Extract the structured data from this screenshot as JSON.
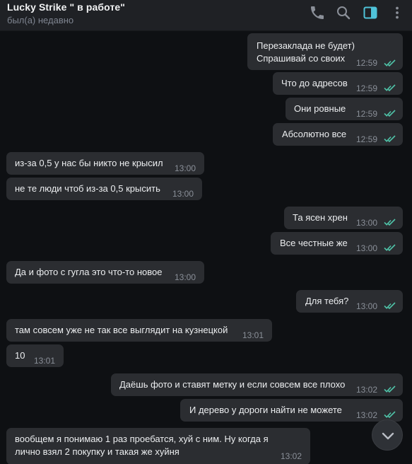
{
  "header": {
    "title": "Lucky Strike \" в работе\"",
    "status": "был(а) недавно"
  },
  "colors": {
    "accent": "#4fc3d9",
    "read_ticks": "#4fc3a8",
    "bubble": "#2b2d31",
    "background": "#0e1013"
  },
  "messages": [
    {
      "dir": "out",
      "lines": [
        "Перезаклада не будет)",
        "Спрашивай со своих"
      ],
      "time": "12:59",
      "read": true
    },
    {
      "dir": "out",
      "lines": [
        "Что до адресов"
      ],
      "time": "12:59",
      "read": true
    },
    {
      "dir": "out",
      "lines": [
        "Они ровные"
      ],
      "time": "12:59",
      "read": true
    },
    {
      "dir": "out",
      "lines": [
        "Абсолютно все"
      ],
      "time": "12:59",
      "read": true
    },
    {
      "dir": "in",
      "lines": [
        "из-за 0,5 у нас бы никто не крысил"
      ],
      "time": "13:00"
    },
    {
      "dir": "in",
      "lines": [
        "не те люди чтоб из-за 0,5 крысить"
      ],
      "time": "13:00"
    },
    {
      "dir": "out",
      "lines": [
        "Та ясен хрен"
      ],
      "time": "13:00",
      "read": true
    },
    {
      "dir": "out",
      "lines": [
        "Все честные же"
      ],
      "time": "13:00",
      "read": true
    },
    {
      "dir": "in",
      "lines": [
        "Да и фото с гугла это что-то новое"
      ],
      "time": "13:00"
    },
    {
      "dir": "out",
      "lines": [
        "Для тебя?"
      ],
      "time": "13:00",
      "read": true
    },
    {
      "dir": "in",
      "lines": [
        "там совсем уже не так все выглядит на кузнецкой"
      ],
      "time": "13:01"
    },
    {
      "dir": "in",
      "lines": [
        "10"
      ],
      "time": "13:01"
    },
    {
      "dir": "out",
      "lines": [
        "Даёшь фото и ставят метку и если совсем все плохо"
      ],
      "time": "13:02",
      "read": true
    },
    {
      "dir": "out",
      "lines": [
        "И дерево у дороги найти не можете"
      ],
      "time": "13:02",
      "read": true
    },
    {
      "dir": "in",
      "lines": [
        "вообщем я понимаю 1 раз проебатся, хуй с ним. Ну когда я",
        "лично взял 2 покупку и такая же хуйня"
      ],
      "time": "13:02"
    }
  ]
}
